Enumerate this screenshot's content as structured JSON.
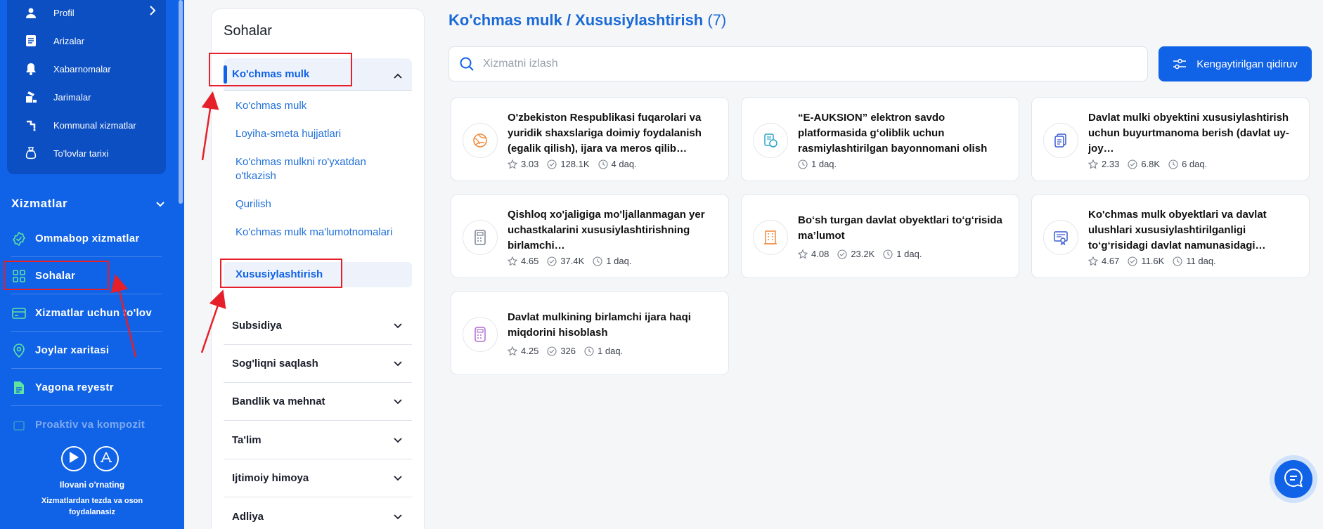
{
  "profile_menu": {
    "items": [
      {
        "label": "Profil",
        "icon": "user-icon"
      },
      {
        "label": "Arizalar",
        "icon": "document-list-icon"
      },
      {
        "label": "Xabarnomalar",
        "icon": "bell-icon"
      },
      {
        "label": "Jarimalar",
        "icon": "fine-icon"
      },
      {
        "label": "Kommunal xizmatlar",
        "icon": "utility-icon"
      },
      {
        "label": "To'lovlar tarixi",
        "icon": "wallet-icon"
      }
    ]
  },
  "sidebar": {
    "section_title": "Xizmatlar",
    "items": [
      {
        "label": "Ommabop xizmatlar",
        "icon": "badge-check-icon"
      },
      {
        "label": "Sohalar",
        "icon": "grid-icon"
      },
      {
        "label": "Xizmatlar uchun to'lov",
        "icon": "card-icon"
      },
      {
        "label": "Joylar xaritasi",
        "icon": "location-pin-icon"
      },
      {
        "label": "Yagona reyestr",
        "icon": "file-icon"
      },
      {
        "label": "Proaktiv va kompozit",
        "icon": "stack-icon"
      }
    ],
    "promo": {
      "title": "Ilovani o'rnating",
      "subtitle": "Xizmatlardan tezda va oson foydalanasiz"
    }
  },
  "categories": {
    "title": "Sohalar",
    "active": "Ko'chmas mulk",
    "subitems": [
      "Ko'chmas mulk",
      "Loyiha-smeta hujjatlari",
      "Ko'chmas mulkni ro'yxatdan o'tkazish",
      "Qurilish",
      "Ko'chmas mulk ma'lumotnomalari",
      "Xususiylashtirish"
    ],
    "others": [
      "Subsidiya",
      "Sog'liqni saqlash",
      "Bandlik va mehnat",
      "Ta'lim",
      "Ijtimoiy himoya",
      "Adliya"
    ]
  },
  "main": {
    "title": "Ko'chmas mulk / Xususiylashtirish",
    "count": "(7)",
    "search_placeholder": "Xizmatni izlash",
    "advanced_search": "Kengaytirilgan qidiruv",
    "cards": [
      {
        "title": "O'zbekiston Respublikasi fuqarolari va yuridik shaxslariga doimiy foydalanish (egalik qilish), ijara va meros qilib…",
        "rating": "3.03",
        "uses": "128.1K",
        "time": "4 daq.",
        "icon": "globe-icon",
        "color": "#f08a3c"
      },
      {
        "title": "“E-AUKSION” elektron savdo platformasida g‘oliblik uchun rasmiylashtirilgan bayonnomani olish",
        "rating": "",
        "uses": "",
        "time": "1 daq.",
        "icon": "money-document-icon",
        "color": "#2aa6c8"
      },
      {
        "title": "Davlat mulki obyektini xususiylashtirish uchun buyurtmanoma berish (davlat uy-joy…",
        "rating": "2.33",
        "uses": "6.8K",
        "time": "6 daq.",
        "icon": "copy-document-icon",
        "color": "#3a5bd0"
      },
      {
        "title": "Qishloq xo'jaligiga mo'ljallanmagan yer uchastkalarini xususiylashtirishning birlamchi…",
        "rating": "4.65",
        "uses": "37.4K",
        "time": "1 daq.",
        "icon": "calculator-icon",
        "color": "#7a8290"
      },
      {
        "title": "Bo‘sh turgan davlat obyektlari to‘g‘risida ma’lumot",
        "rating": "4.08",
        "uses": "23.2K",
        "time": "1 daq.",
        "icon": "building-icon",
        "color": "#f08a3c"
      },
      {
        "title": "Ko'chmas mulk obyektlari va davlat ulushlari xususiylashtirilganligi to‘g‘risidagi davlat namunasidagi…",
        "rating": "4.67",
        "uses": "11.6K",
        "time": "11 daq.",
        "icon": "certificate-icon",
        "color": "#3a5bd0"
      },
      {
        "title": "Davlat mulkining birlamchi ijara haqi miqdorini hisoblash",
        "rating": "4.25",
        "uses": "326",
        "time": "1 daq.",
        "icon": "calculator-icon",
        "color": "#b06bd0"
      }
    ]
  }
}
